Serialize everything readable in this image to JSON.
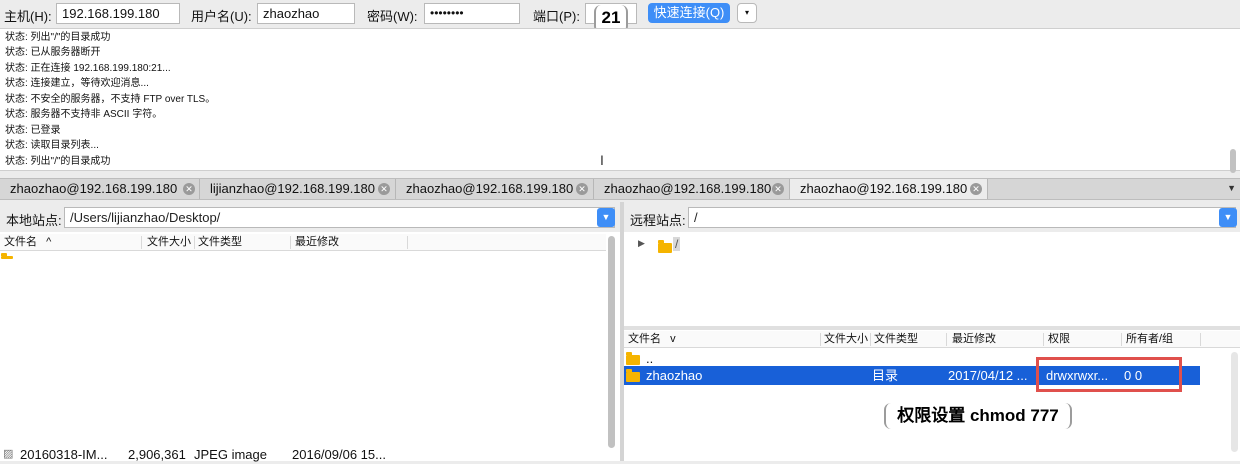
{
  "quickconnect": {
    "host_label": "主机(H):",
    "host_value": "192.168.199.180",
    "user_label": "用户名(U):",
    "user_value": "zhaozhao",
    "password_label": "密码(W):",
    "password_value": "••••••••",
    "port_label": "端口(P):",
    "port_value": "21",
    "connect_button": "快速连接(Q)",
    "dropdown_icon": "▾"
  },
  "log": [
    "状态: 列出\"/\"的目录成功",
    "状态: 已从服务器断开",
    "状态: 正在连接 192.168.199.180:21...",
    "状态: 连接建立，等待欢迎消息...",
    "状态: 不安全的服务器，不支持 FTP over TLS。",
    "状态: 服务器不支持非 ASCII 字符。",
    "状态: 已登录",
    "状态: 读取目录列表...",
    "状态: 列出\"/\"的目录成功"
  ],
  "tabs": [
    {
      "label": "zhaozhao@192.168.199.180",
      "active": false
    },
    {
      "label": "lijianzhao@192.168.199.180",
      "active": false
    },
    {
      "label": "zhaozhao@192.168.199.180",
      "active": false
    },
    {
      "label": "zhaozhao@192.168.199.180",
      "active": false
    },
    {
      "label": "zhaozhao@192.168.199.180",
      "active": true
    }
  ],
  "local": {
    "site_label": "本地站点:",
    "path": "/Users/lijianzhao/Desktop/",
    "columns": {
      "name": "文件名",
      "size": "文件大小",
      "type": "文件类型",
      "modified": "最近修改"
    },
    "sort_icon": "^",
    "files": [
      {
        "name": "20160318-IM...",
        "size": "2,906,361",
        "type": "JPEG image",
        "modified": "2016/09/06 15..."
      }
    ]
  },
  "remote": {
    "site_label": "远程站点:",
    "path": "/",
    "tree_root": "/",
    "columns": {
      "name": "文件名",
      "size": "文件大小",
      "type": "文件类型",
      "modified": "最近修改",
      "permissions": "权限",
      "owner": "所有者/组"
    },
    "sort_icon": "v",
    "files": [
      {
        "name": "..",
        "type": "",
        "modified": "",
        "permissions": "",
        "owner": ""
      },
      {
        "name": "zhaozhao",
        "type": "目录",
        "modified": "2017/04/12 ...",
        "permissions": "drwxrwxr...",
        "owner": "0 0"
      }
    ]
  },
  "annotation": {
    "port_callout": "21",
    "chmod_callout": "权限设置 chmod 777"
  },
  "colors": {
    "accent": "#3e8ef7",
    "selection": "#1860d8",
    "highlight_box": "#e0504c",
    "folder": "#f5b400"
  }
}
